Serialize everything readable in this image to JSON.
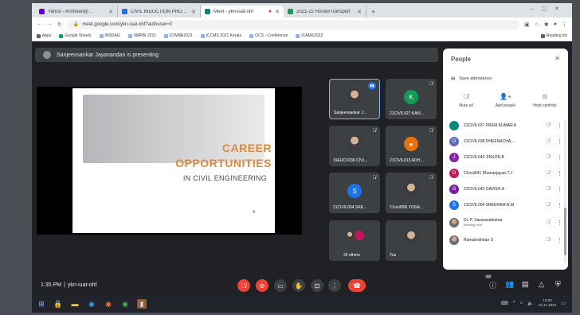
{
  "browser": {
    "tabs": [
      {
        "title": "Yahoo - krishnan@...",
        "favicon_color": "#6001d2"
      },
      {
        "title": "CIVIL INDUCTION PROGRAMME",
        "favicon_color": "#1a73e8"
      },
      {
        "title": "Meet - ykn-iuat-ohf",
        "favicon_color": "#00897b",
        "active": true
      },
      {
        "title": "2021-22 Hostel/Transport",
        "favicon_color": "#0f9d58"
      }
    ],
    "new_tab": "+",
    "url": "meet.google.com/ykn-iuat-ohf?authuser=0",
    "bookmarks": [
      "Apps",
      "Google Sheets",
      "INSDAG",
      "SMRBI 2021",
      "ICWMR2021",
      "ICCMS 2021 Kerala",
      "OCS - Conference",
      "ICAMS2022"
    ],
    "reading_list": "Reading list"
  },
  "meet": {
    "presenting_text": "Sanjeevsankar Jayanandan is presenting",
    "slide": {
      "title_line1": "CAREER",
      "title_line2": "OPPORTUNITIES",
      "subtitle": "IN CIVIL ENGINEERING",
      "marker": "x"
    },
    "tiles": [
      {
        "name": "Sanjeevsankar J...",
        "kind": "photo",
        "selected": true,
        "speaking": true
      },
      {
        "name": "21CIVIL027 KAVI...",
        "kind": "letter",
        "letter": "K",
        "color": "#0f9d58"
      },
      {
        "name": "19EUCV030 CIVI...",
        "kind": "photo"
      },
      {
        "name": "21CIVIL013 ADH...",
        "kind": "letter",
        "letter": "",
        "color": "#e8710a"
      },
      {
        "name": "21CIVIL004 SRE...",
        "kind": "letter",
        "letter": "S",
        "color": "#1a73e8"
      },
      {
        "name": "21civil006 YOGA...",
        "kind": "photo"
      },
      {
        "name": "33 others",
        "kind": "others"
      },
      {
        "name": "You",
        "kind": "photo"
      }
    ],
    "meeting_time": "1:35 PM",
    "separator": "|",
    "meeting_code": "ykn-iuat-ohf",
    "badge_count": "41"
  },
  "people_panel": {
    "title": "People",
    "save_attendance": "Save attendance",
    "actions": {
      "mute_all": "Mute all",
      "add_people": "Add people",
      "host_controls": "Host controls"
    },
    "participants": [
      {
        "name": "21CIVIL037 PREM KUMAR A",
        "letter": "",
        "color": "#00897b"
      },
      {
        "name": "21CIVIL038 DHEENACHA...",
        "letter": "D",
        "color": "#5c6bc0"
      },
      {
        "name": "21CIVIL040 JINSON.B",
        "letter": "J",
        "color": "#8e24aa"
      },
      {
        "name": "21civil041 Dhananjayan.T.J",
        "letter": "D",
        "color": "#c2185b"
      },
      {
        "name": "21CIVIL042 GAVISH.A",
        "letter": "G",
        "color": "#7b1fa2"
      },
      {
        "name": "21CIVIL004 SREERAM.N.M",
        "letter": "S",
        "color": "#1a73e8"
      },
      {
        "name": "Dr. P. Saravanakumar",
        "sub": "Meeting host",
        "letter": "",
        "color": "",
        "photo": true
      },
      {
        "name": "Ramakrishnan S",
        "letter": "",
        "color": "",
        "photo": true
      }
    ]
  },
  "taskbar": {
    "time": "13:00",
    "date": "13-11-2021"
  }
}
